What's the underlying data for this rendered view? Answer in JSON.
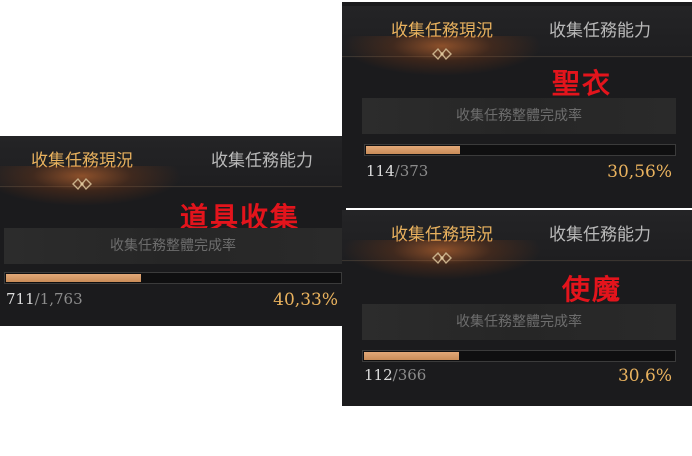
{
  "panels": [
    {
      "tab_active": "收集任務現況",
      "tab_inactive": "收集任務能力",
      "category": "道具收集",
      "rate_label": "收集任務整體完成率",
      "collected": "711",
      "separator": "/",
      "total": "1,763",
      "percent": "40,33%",
      "progress_fraction": 0.4033
    },
    {
      "tab_active": "收集任務現況",
      "tab_inactive": "收集任務能力",
      "category": "聖衣",
      "rate_label": "收集任務整體完成率",
      "collected": "114",
      "separator": "/",
      "total": "373",
      "percent": "30,56%",
      "progress_fraction": 0.3056
    },
    {
      "tab_active": "收集任務現況",
      "tab_inactive": "收集任務能力",
      "category": "使魔",
      "rate_label": "收集任務整體完成率",
      "collected": "112",
      "separator": "/",
      "total": "366",
      "percent": "30,6%",
      "progress_fraction": 0.306
    }
  ],
  "colors": {
    "active_tab": "#e9b25e",
    "inactive_tab": "#b9b9b9",
    "category_label": "#e3141c",
    "progress_fill": "#d89c68",
    "percent_text": "#e9b25e"
  }
}
